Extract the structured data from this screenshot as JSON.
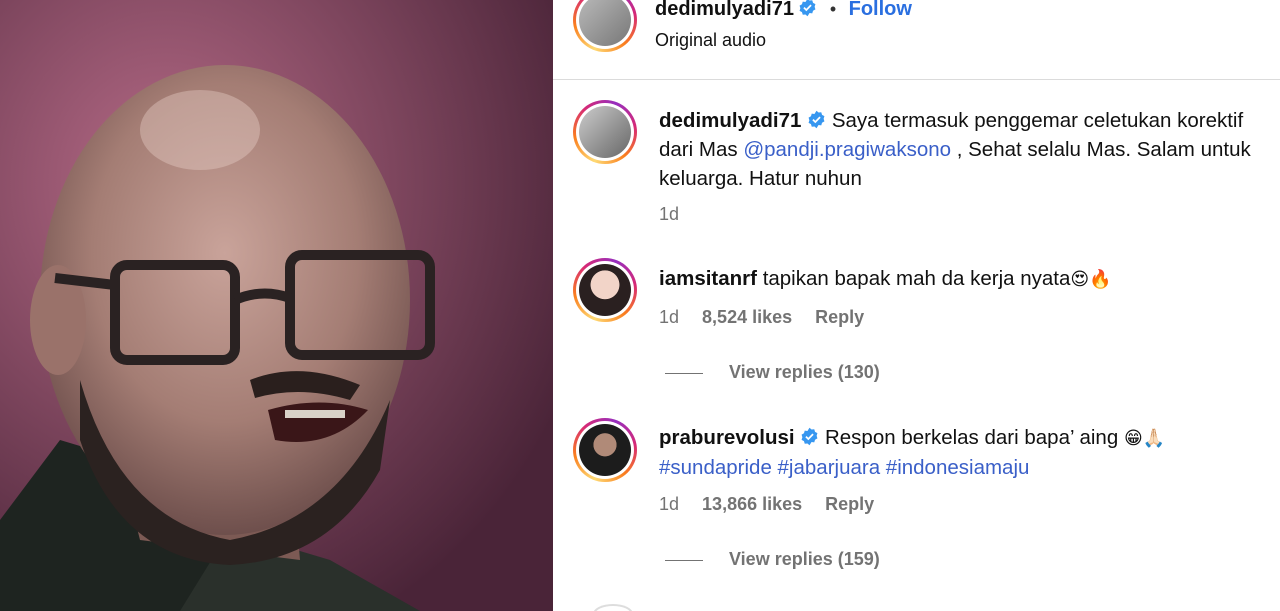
{
  "post": {
    "author": "dedimulyadi71",
    "separator": "•",
    "follow_label": "Follow",
    "audio_label": "Original audio"
  },
  "caption": {
    "username": "dedimulyadi71",
    "text_before": "Saya termasuk penggemar celetukan korektif dari Mas ",
    "mention": "@pandji.pragiwaksono",
    "text_after": " , Sehat selalu Mas. Salam untuk keluarga. Hatur nuhun",
    "time": "1d"
  },
  "comments": [
    {
      "username": "iamsitanrf",
      "text": "tapikan bapak mah da kerja nyata",
      "emoji": "😍🔥",
      "time": "1d",
      "likes": "8,524 likes",
      "reply_label": "Reply",
      "view_replies": "View replies (130)",
      "verified": false
    },
    {
      "username": "praburevolusi",
      "text": "Respon berkelas dari bapa’ aing",
      "emoji": "😁🙏🏻",
      "hashtags": "#sundapride #jabarjuara #indonesiamaju",
      "time": "1d",
      "likes": "13,866 likes",
      "reply_label": "Reply",
      "view_replies": "View replies (159)",
      "verified": true
    }
  ],
  "colors": {
    "accent": "#2a6fe0",
    "link": "#3a5fc8",
    "muted": "#737373",
    "verified": "#3797f0"
  },
  "icons": [
    "verified-badge-icon",
    "avatar-ring"
  ]
}
